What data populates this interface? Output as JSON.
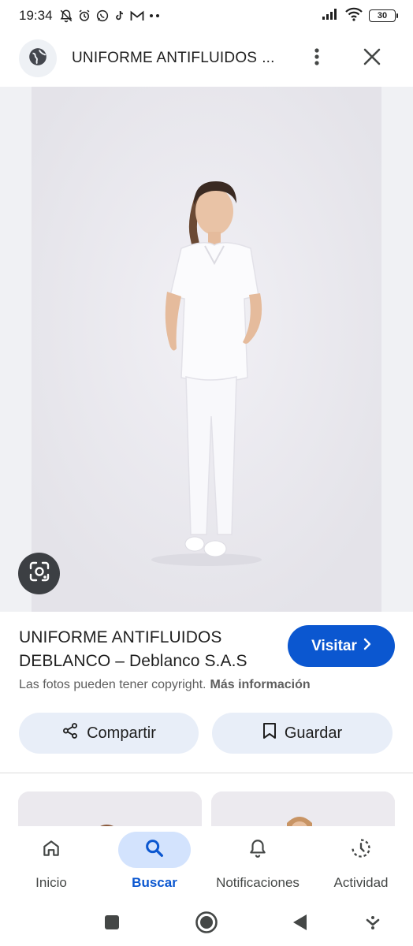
{
  "status_bar": {
    "time": "19:34",
    "battery": "30",
    "left_icons": [
      "mute-icon",
      "alarm-icon",
      "whatsapp-icon",
      "tiktok-icon",
      "gmail-icon",
      "more-dots-icon"
    ],
    "right_icons": [
      "signal-icon",
      "wifi-icon",
      "battery-icon"
    ]
  },
  "header": {
    "title": "UNIFORME ANTIFLUIDOS",
    "title_ellipsis": "...",
    "globe_icon": "globe-icon",
    "more_icon": "more-vert-icon",
    "close_icon": "close-icon"
  },
  "image": {
    "description_icon": "lens-icon"
  },
  "info": {
    "title": "UNIFORME ANTIFLUIDOS DEBLANCO – Deblanco S.A.S",
    "visit_label": "Visitar",
    "copyright_text": "Las fotos pueden tener copyright.",
    "more_info": "Más información",
    "share_label": "Compartir",
    "save_label": "Guardar"
  },
  "bottom_nav": {
    "items": [
      {
        "label": "Inicio",
        "icon": "home-icon"
      },
      {
        "label": "Buscar",
        "icon": "search-icon",
        "active": true
      },
      {
        "label": "Notificaciones",
        "icon": "bell-icon"
      },
      {
        "label": "Actividad",
        "icon": "activity-icon"
      }
    ]
  },
  "system_nav": {
    "icons": [
      "recents-icon",
      "home-circle-icon",
      "back-icon",
      "assist-icon"
    ]
  },
  "colors": {
    "accent": "#0b57d0",
    "pill_bg": "#e8eef8",
    "active_nav_bg": "#d3e3fd",
    "lens_bg": "#3c3f43"
  }
}
